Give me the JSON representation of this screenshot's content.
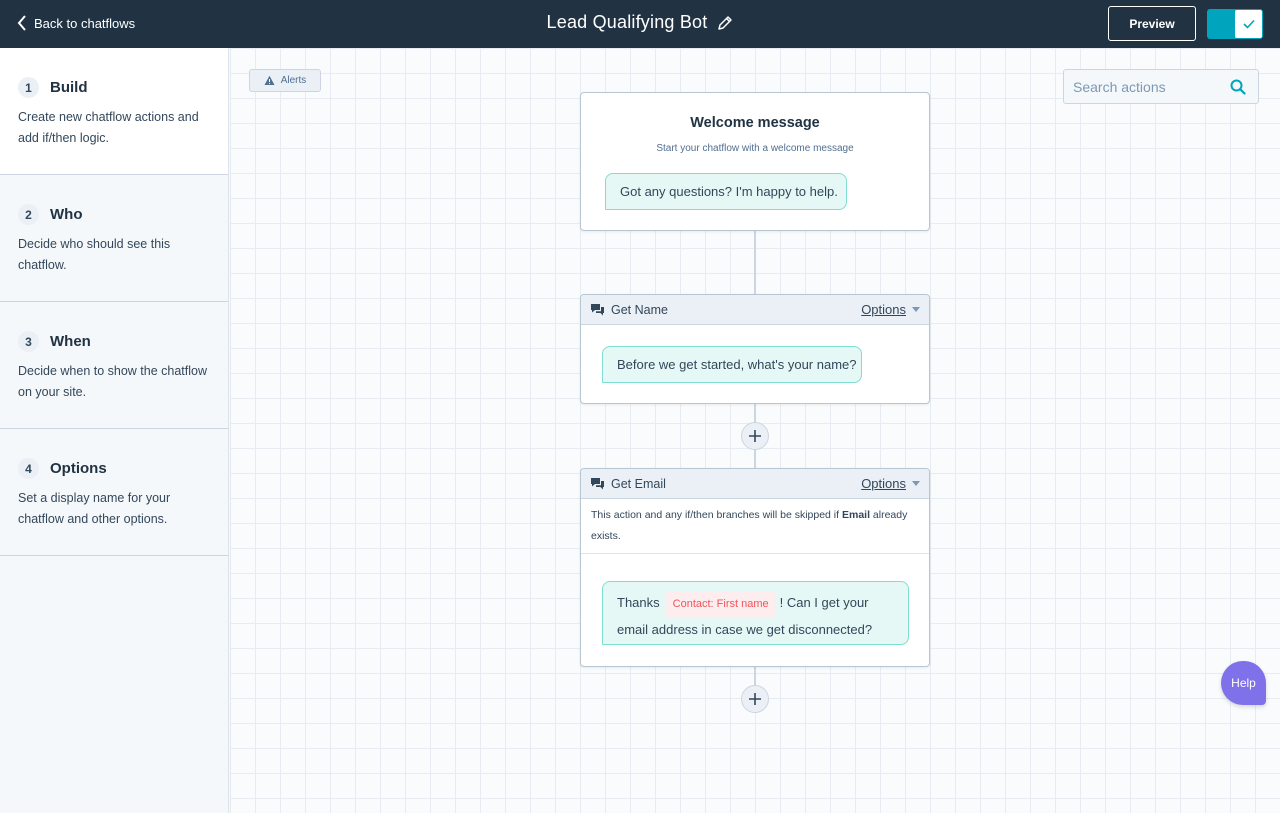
{
  "header": {
    "back_label": "Back to chatflows",
    "title": "Lead Qualifying Bot",
    "preview_label": "Preview",
    "toggle_state": "on"
  },
  "sidebar": {
    "steps": [
      {
        "number": "1",
        "title": "Build",
        "description": "Create new chatflow actions and add if/then logic."
      },
      {
        "number": "2",
        "title": "Who",
        "description": "Decide who should see this chatflow."
      },
      {
        "number": "3",
        "title": "When",
        "description": "Decide when to show the chatflow on your site."
      },
      {
        "number": "4",
        "title": "Options",
        "description": "Set a display name for your chatflow and other options."
      }
    ]
  },
  "canvas": {
    "alerts_label": "Alerts",
    "search": {
      "placeholder": "Search actions",
      "value": ""
    },
    "welcome": {
      "title": "Welcome message",
      "subtitle": "Start your chatflow with a welcome message",
      "message": "Got any questions? I'm happy to help."
    },
    "get_name": {
      "label": "Get Name",
      "options_label": "Options",
      "message": "Before we get started, what's your name?"
    },
    "get_email": {
      "label": "Get Email",
      "options_label": "Options",
      "note_prefix": "This action and any if/then branches will be skipped if ",
      "note_bold": "Email",
      "note_suffix": " already exists.",
      "message_prefix": "Thanks",
      "token": "Contact: First name",
      "message_suffix": "! Can I get your email address in case we get disconnected?"
    }
  },
  "help_label": "Help",
  "icons": {
    "back": "chevron-left-icon",
    "edit": "pencil-icon",
    "toggle": "check-icon",
    "alerts": "warning-icon",
    "search": "search-icon",
    "action": "chat-bubbles-icon",
    "add": "plus-icon"
  },
  "colors": {
    "topbar": "#213343",
    "accent": "#00a4bd",
    "bubble": "#e5f8f6",
    "token": "#f2545b",
    "help": "#7e71ea"
  }
}
